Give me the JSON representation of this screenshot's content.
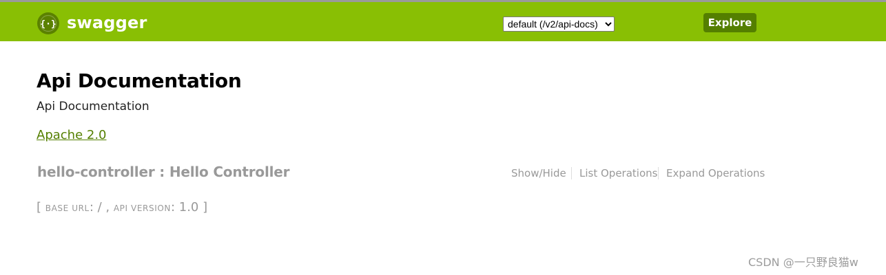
{
  "header": {
    "logo_icon": "swagger-logo-icon",
    "logo_text": "swagger",
    "api_select": {
      "selected": "default (/v2/api-docs)",
      "options": [
        "default (/v2/api-docs)"
      ]
    },
    "explore_label": "Explore"
  },
  "info": {
    "title": "Api Documentation",
    "description": "Api Documentation",
    "license_link": "Apache 2.0"
  },
  "resource": {
    "title": "hello-controller : Hello Controller",
    "operations": {
      "show_hide": "Show/Hide",
      "list_operations": "List Operations",
      "expand_operations": "Expand Operations"
    }
  },
  "footer": {
    "open_bracket": "[",
    "base_url_label": "base url",
    "base_url_value": ": / ,",
    "api_version_label": "api version",
    "api_version_value": ": 1.0",
    "close_bracket": "]"
  },
  "watermark": "CSDN @一只野良猫w",
  "colors": {
    "header_bg": "#89bf04",
    "explore_bg": "#547f00",
    "link": "#547f00",
    "muted_text": "#999999"
  }
}
